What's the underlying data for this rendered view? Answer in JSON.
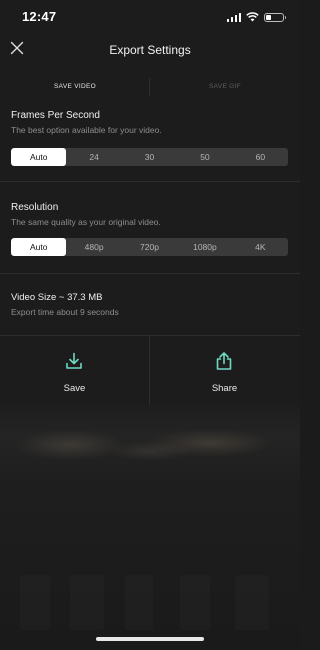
{
  "status_bar": {
    "time": "12:47"
  },
  "header": {
    "title": "Export Settings"
  },
  "tabs": [
    {
      "label": "SAVE VIDEO",
      "active": true
    },
    {
      "label": "SAVE GIF",
      "active": false
    }
  ],
  "fps": {
    "title": "Frames Per Second",
    "subtitle": "The best option available for your video.",
    "options": [
      "Auto",
      "24",
      "30",
      "50",
      "60"
    ],
    "selected": "Auto"
  },
  "resolution": {
    "title": "Resolution",
    "subtitle": "The same quality as your original video.",
    "options": [
      "Auto",
      "480p",
      "720p",
      "1080p",
      "4K"
    ],
    "selected": "Auto"
  },
  "video_info": {
    "size": "Video Size ~ 37.3 MB",
    "export_time": "Export time about 9 seconds"
  },
  "actions": {
    "save_label": "Save",
    "share_label": "Share"
  },
  "colors": {
    "background": "#1c1c1c",
    "accent_icon": "#6fd8c4",
    "selected_segment": "#ffffff",
    "segment_bg": "#3a3a3a"
  },
  "icons": {
    "close": "close-icon",
    "save": "download-icon",
    "share": "share-icon"
  }
}
